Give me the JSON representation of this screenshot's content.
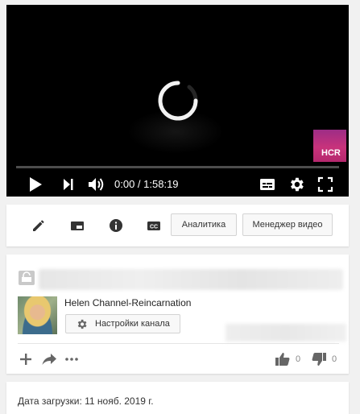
{
  "player": {
    "current_time": "0:00",
    "separator": " / ",
    "duration": "1:58:19",
    "progress_fraction": 0.0,
    "watermark_text": "HCR",
    "controls": [
      "play-icon",
      "next-icon",
      "volume-icon",
      "subtitles-icon",
      "settings-gear-icon",
      "fullscreen-icon"
    ]
  },
  "actions": {
    "icons": [
      "pencil-icon",
      "card-icon",
      "info-icon",
      "cc-icon"
    ],
    "analytics_label": "Аналитика",
    "video_manager_label": "Менеджер видео"
  },
  "channel": {
    "name": "Helen Channel-Reincarnation",
    "settings_label": "Настройки канала",
    "likes": "0",
    "dislikes": "0",
    "bottom_icons": [
      "add-icon",
      "share-icon",
      "more-icon"
    ]
  },
  "details": {
    "upload_date": "Дата загрузки: 11 нояб. 2019 г."
  },
  "colors": {
    "page_bg": "#f1f1f1",
    "player_bg": "#000000",
    "icon_gray": "#555555"
  }
}
